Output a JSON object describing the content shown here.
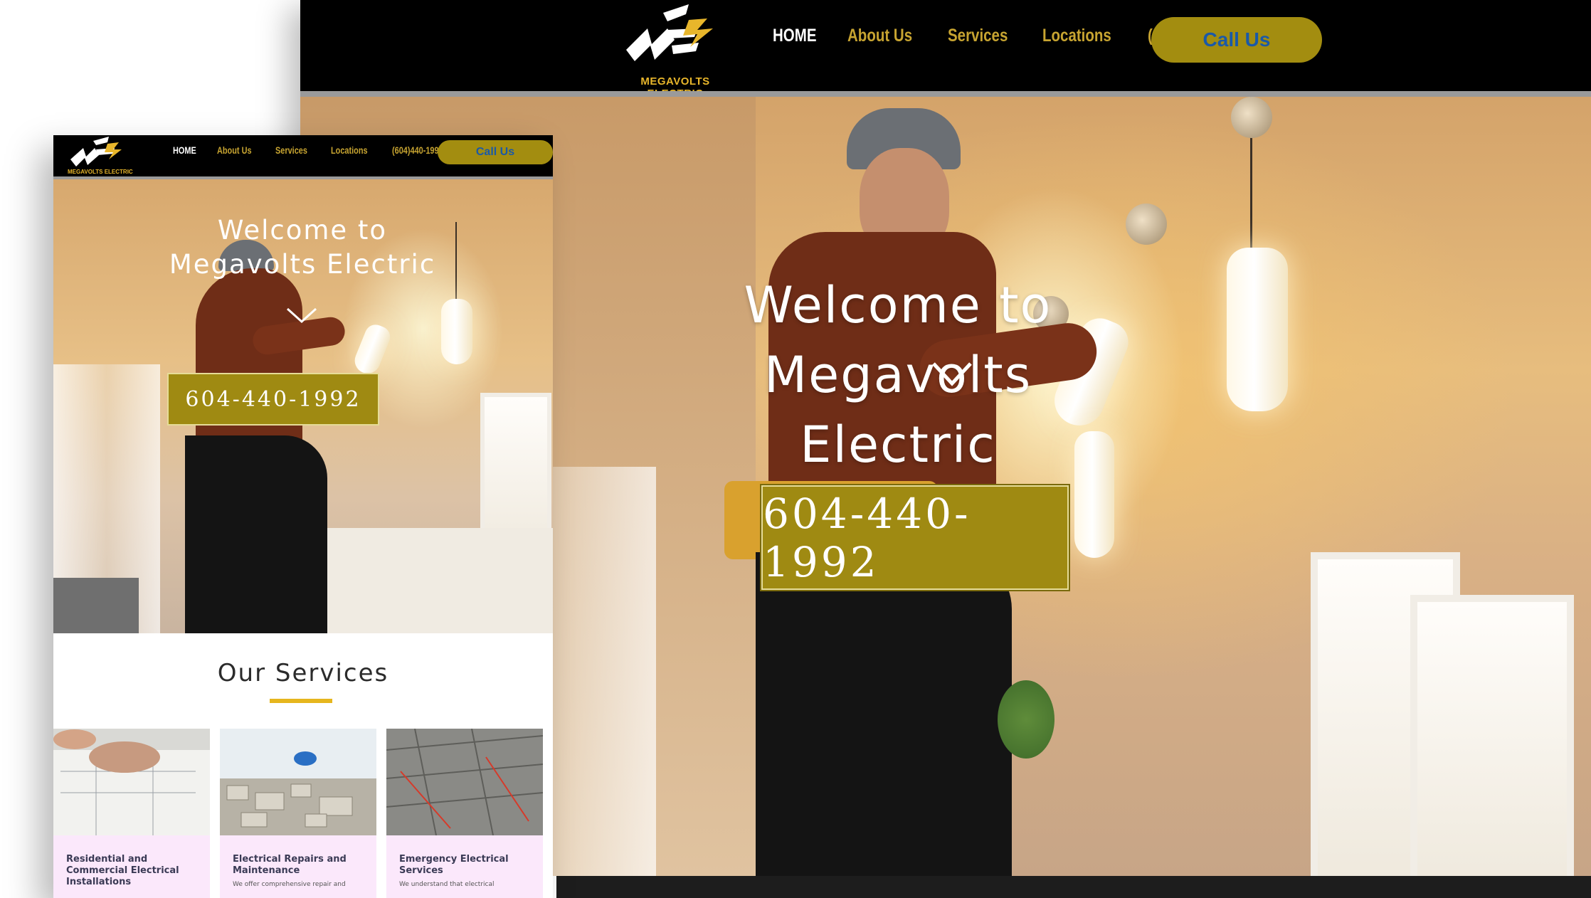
{
  "brand": {
    "name": "MEGAVOLTS ELECTRIC",
    "colors": {
      "nav_bg": "#000000",
      "accent_gold": "#c7a431",
      "button_bg": "#a38d10",
      "button_text": "#1a59a8",
      "bolt": "#e8b62b"
    }
  },
  "nav": {
    "items": [
      {
        "label": "HOME",
        "active": true
      },
      {
        "label": "About Us"
      },
      {
        "label": "Services"
      },
      {
        "label": "Locations"
      },
      {
        "label": "(604)440-1992"
      }
    ],
    "call_button": "Call Us"
  },
  "hero": {
    "title_line1": "Welcome to",
    "title_line2": "Megavolts Electric",
    "scroll_icon": "chevron-down-icon",
    "phone_button": "604-440-1992"
  },
  "services": {
    "title": "Our Services",
    "cards": [
      {
        "title": "Residential and Commercial Electrical Installations",
        "desc": ""
      },
      {
        "title": "Electrical Repairs and Maintenance",
        "desc": "We offer comprehensive repair and"
      },
      {
        "title": "Emergency Electrical Services",
        "desc": "We understand that electrical"
      }
    ]
  }
}
